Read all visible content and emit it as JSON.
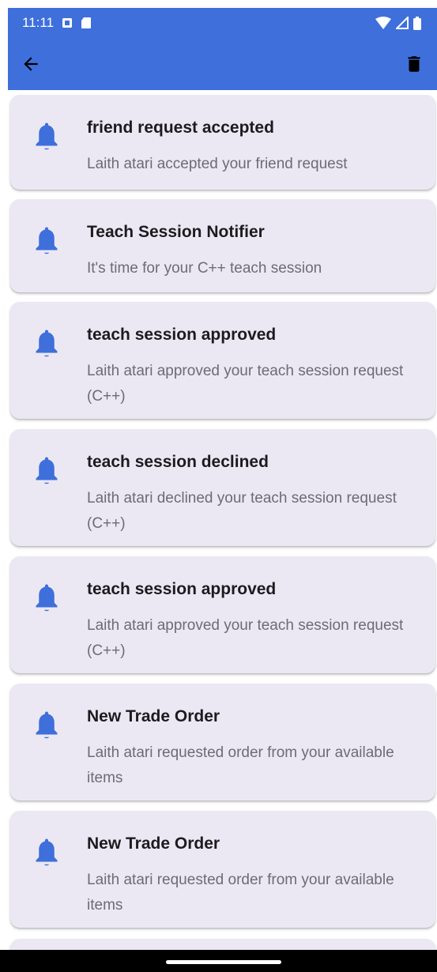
{
  "status_bar": {
    "time": "11:11",
    "icons": [
      "sim-notification-icon",
      "sd-card-icon",
      "wifi-icon",
      "signal-icon",
      "battery-icon"
    ]
  },
  "app_bar": {
    "back_icon": "arrow-back-icon",
    "delete_icon": "trash-icon"
  },
  "colors": {
    "primary": "#3f6fdb",
    "card_background": "#ece8f3",
    "title_text": "#1c1b1f",
    "body_text": "#6f6b74",
    "bell": "#3f6fdb"
  },
  "notifications": [
    {
      "title": "friend request accepted",
      "body": "Laith atari accepted your friend request",
      "icon": "bell-icon"
    },
    {
      "title": "Teach Session Notifier",
      "body": "It's time for your C++ teach session",
      "icon": "bell-icon"
    },
    {
      "title": "teach session approved",
      "body": "Laith atari approved your teach session request (C++)",
      "icon": "bell-icon"
    },
    {
      "title": "teach session declined",
      "body": "Laith atari declined your teach session request (C++)",
      "icon": "bell-icon"
    },
    {
      "title": "teach session approved",
      "body": "Laith atari approved your teach session request (C++)",
      "icon": "bell-icon"
    },
    {
      "title": "New Trade Order",
      "body": "Laith atari requested order from your available items",
      "icon": "bell-icon"
    },
    {
      "title": "New Trade Order",
      "body": "Laith atari requested order from your available items",
      "icon": "bell-icon"
    }
  ]
}
